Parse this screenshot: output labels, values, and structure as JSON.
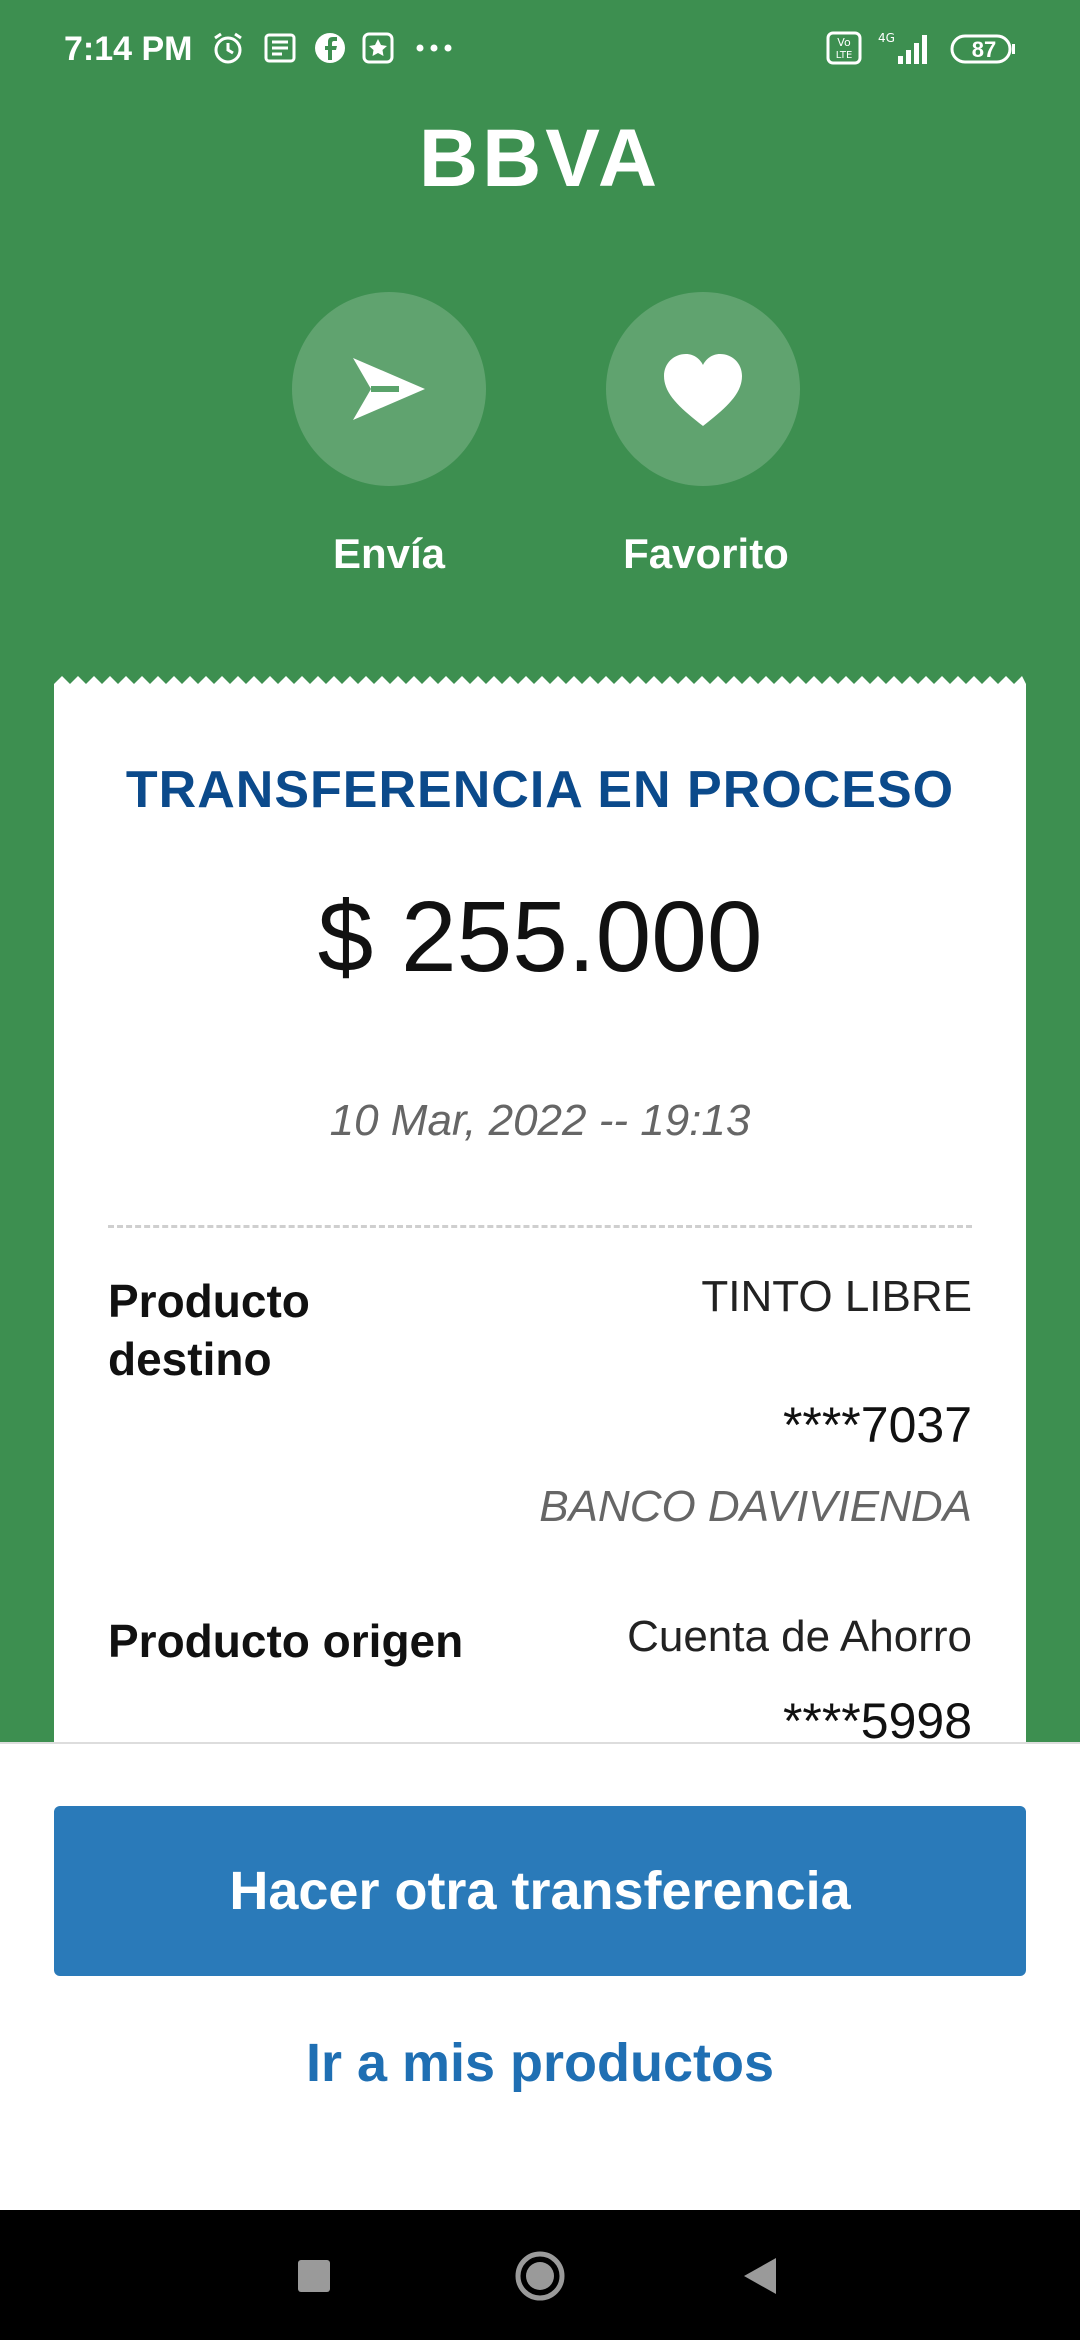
{
  "status_bar": {
    "time": "7:14 PM",
    "icons": [
      "alarm-icon",
      "news-icon",
      "facebook-icon",
      "star-app-icon",
      "more-dots-icon"
    ],
    "right_icons": [
      "volte-icon",
      "signal-4g-icon"
    ],
    "battery": "87"
  },
  "header": {
    "logo": "BBVA"
  },
  "actions": [
    {
      "label": "Envía",
      "icon": "send-icon"
    },
    {
      "label": "Favorito",
      "icon": "heart-icon"
    }
  ],
  "receipt": {
    "title": "TRANSFERENCIA EN PROCESO",
    "amount": "$ 255.000",
    "date": "10 Mar, 2022 -- 19:13",
    "destination": {
      "label": "Producto destino",
      "name": "TINTO LIBRE",
      "account": "****7037",
      "bank": "BANCO DAVIVIENDA"
    },
    "origin": {
      "label": "Producto origen",
      "name": "Cuenta de Ahorro",
      "account": "****5998"
    }
  },
  "bottom": {
    "primary_button": "Hacer otra transferencia",
    "secondary_link": "Ir a mis productos"
  },
  "nav": [
    "recents-button",
    "home-button",
    "back-button"
  ]
}
